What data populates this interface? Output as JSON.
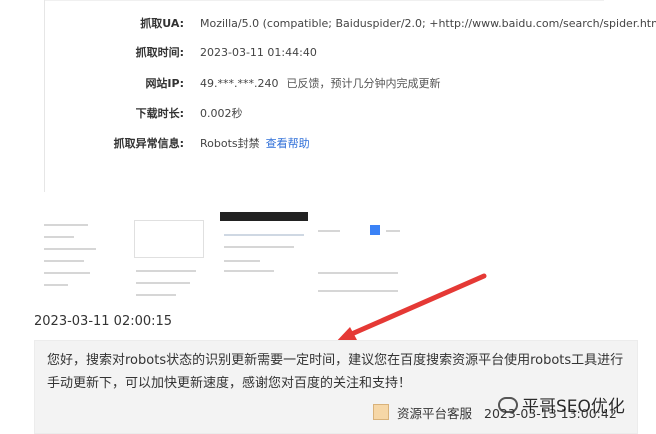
{
  "info_rows": [
    {
      "label": "抓取UA:",
      "value": "Mozilla/5.0 (compatible; Baiduspider/2.0; +http://www.baidu.com/search/spider.html)"
    },
    {
      "label": "抓取时间:",
      "value": "2023-03-11 01:44:40"
    },
    {
      "label": "网站IP:",
      "value": "49.***.***.240",
      "note": "已反馈，预计几分钟内完成更新"
    },
    {
      "label": "下载时长:",
      "value": "0.002秒"
    },
    {
      "label": "抓取异常信息:",
      "value": "Robots封禁",
      "link": "查看帮助"
    }
  ],
  "message": {
    "time": "2023-03-11 02:00:15",
    "reply_text": "您好，搜索对robots状态的识别更新需要一定时间，建议您在百度搜索资源平台使用robots工具进行手动更新下，可以加快更新速度，感谢您对百度的关注和支持！",
    "author": "资源平台客服",
    "reply_time": "2023-03-13 13:00:42"
  },
  "watermark": "平哥SEO优化",
  "colors": {
    "link": "#2f6fd8",
    "arrow": "#e53935",
    "box": "#f3f3f3"
  }
}
